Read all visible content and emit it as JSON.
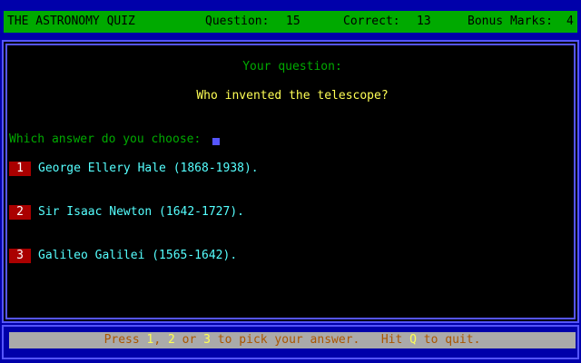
{
  "header": {
    "title": "THE ASTRONOMY QUIZ",
    "question_label": "Question:",
    "question_number": "15",
    "correct_label": "Correct:",
    "correct_count": "13",
    "bonus_label": "Bonus Marks:",
    "bonus_count": "4"
  },
  "main": {
    "question_heading": "Your question:",
    "question_text": "Who invented the telescope?",
    "prompt": "Which answer do you choose:",
    "answers": [
      {
        "number": "1",
        "text": "George Ellery Hale (1868-1938)."
      },
      {
        "number": "2",
        "text": "Sir Isaac Newton (1642-1727)."
      },
      {
        "number": "3",
        "text": "Galileo Galilei (1565-1642)."
      }
    ]
  },
  "footer": {
    "press": "Press ",
    "key1": "1",
    "sep1": ", ",
    "key2": "2",
    "sep2": " or ",
    "key3": "3",
    "pick": " to pick your answer.   Hit ",
    "keyq": "Q",
    "quit": " to quit."
  },
  "colors": {
    "background": "#0000aa",
    "header_bar": "#00aa00",
    "panel": "#000000",
    "number_badge": "#aa0000",
    "help_bar": "#aaaaaa"
  }
}
